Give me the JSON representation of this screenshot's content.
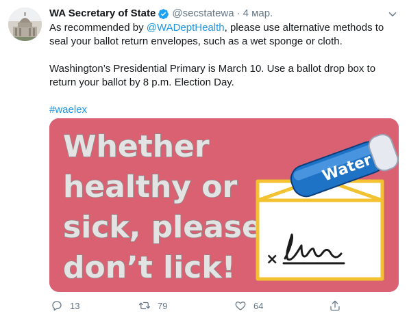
{
  "tweet": {
    "author_name": "WA Secretary of State",
    "author_handle": "@secstatewa",
    "separator": "·",
    "timestamp": "4 мар.",
    "text_line1_pre": "As recommended by ",
    "mention": "@WADeptHealth",
    "text_line1_post": ", please use alternative methods to seal your ballot return envelopes, such as a wet sponge or cloth.",
    "text_para2": "Washington’s Presidential Primary is March 10. Use a ballot drop box to return your ballot by 8 p.m. Election Day.",
    "hashtag": "#waelex"
  },
  "media": {
    "headline_lines": [
      "Whether",
      "healthy or",
      "sick, please",
      "don’t lick!"
    ],
    "sponge_label": "Water",
    "signature_mark": "×",
    "colors": {
      "background": "#d96172",
      "text": "#e3e3e3",
      "envelope_border": "#f2c230",
      "sponge": "#1e73c6"
    }
  },
  "actions": {
    "reply_count": "13",
    "retweet_count": "79",
    "like_count": "64"
  },
  "colors": {
    "link": "#1b95e0",
    "verified": "#1da1f2",
    "muted": "#657786"
  }
}
